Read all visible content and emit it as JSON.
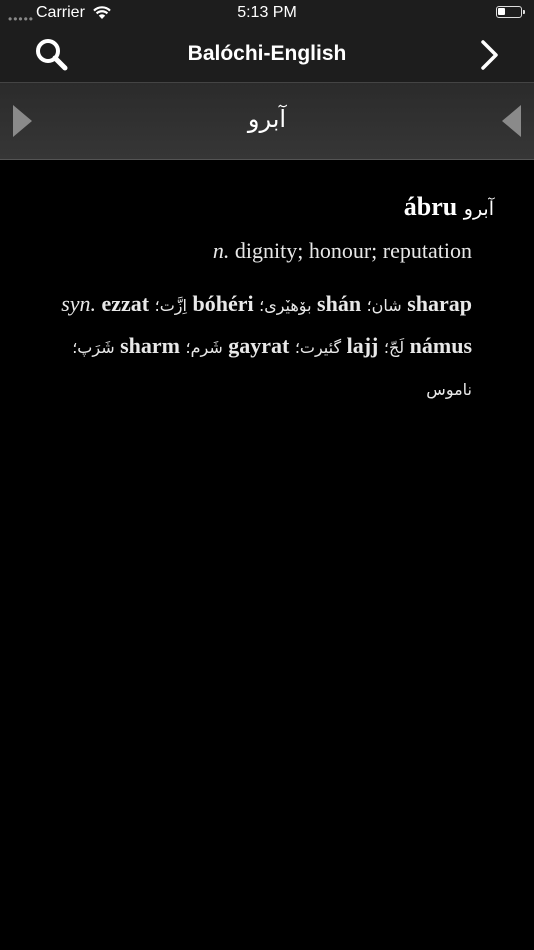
{
  "status_bar": {
    "signal": "•••••",
    "carrier": "Carrier",
    "time": "5:13 PM"
  },
  "nav": {
    "title": "Balóchi-English",
    "left_icon": "search-icon",
    "right_icon": "chevron-right-icon"
  },
  "word_bar": {
    "title": "آبرو",
    "left_icon": "triangle-right-icon",
    "right_icon": "triangle-left-icon"
  },
  "entry": {
    "headword": "ábru",
    "headword_script": "آبرو",
    "pos": "n.",
    "definition": "dignity; honour; reputation",
    "syn_label": "syn.",
    "separator": "؛",
    "synonyms": [
      {
        "word": "ezzat",
        "script": "اِزَّت"
      },
      {
        "word": "bóhéri",
        "script": "بۆهیٚری"
      },
      {
        "word": "shán",
        "script": "شان"
      },
      {
        "word": "sharap",
        "script": "شَرَپ"
      },
      {
        "word": "sharm",
        "script": "شَرم"
      },
      {
        "word": "gayrat",
        "script": "گئیرت"
      },
      {
        "word": "lajj",
        "script": "لَجّ"
      },
      {
        "word": "námus",
        "script": "ناموس"
      }
    ]
  }
}
